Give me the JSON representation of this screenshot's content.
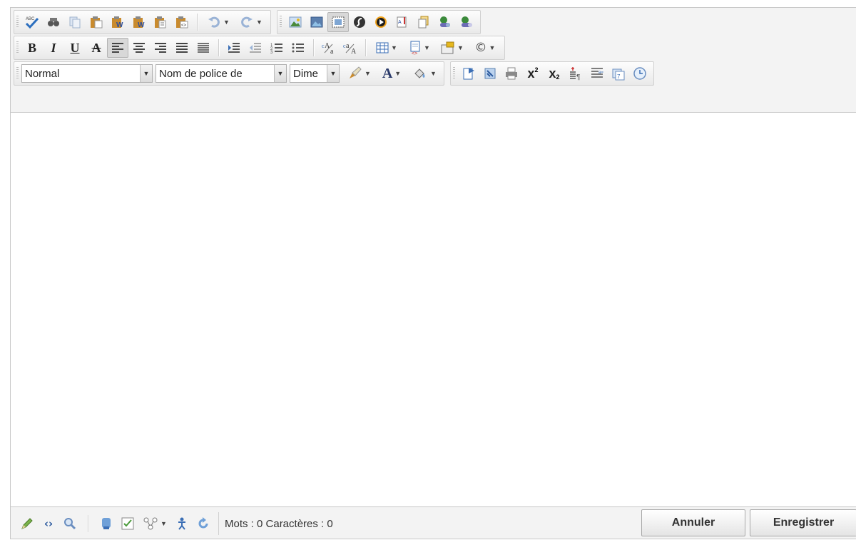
{
  "toolbar": {
    "style_combo": "Normal",
    "font_combo": "Nom de police de",
    "size_combo": "Dime",
    "bold_label": "B",
    "italic_label": "I",
    "underline_label": "U",
    "strike_label": "A",
    "font_color_label": "A",
    "superscript_label": "x",
    "subscript_label": "x"
  },
  "status": {
    "counter": "Mots : 0 Caractères : 0"
  },
  "buttons": {
    "cancel": "Annuler",
    "save": "Enregistrer"
  },
  "colors": {
    "toolbar_bg": "#f3f3f3",
    "border": "#c8c8c8",
    "content_bg": "#ffffff"
  }
}
